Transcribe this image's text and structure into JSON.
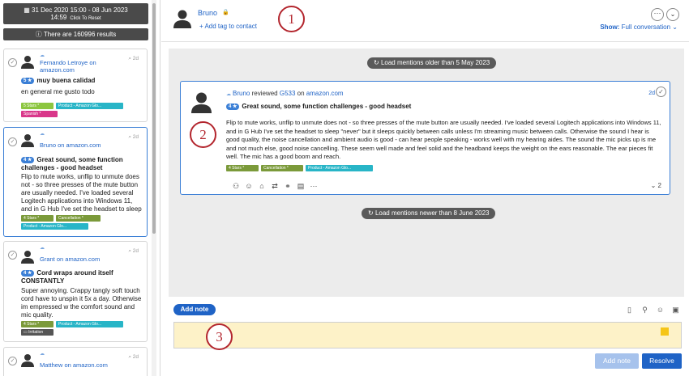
{
  "sidebar": {
    "date_range": "31 Dec 2020 15:00 - 08 Jun 2023",
    "date_time": "14:59",
    "reset_label": "Click To Reset",
    "results": "There are 160996 results",
    "cards": [
      {
        "name": "Fernando Letroye",
        "source": "on amazon.com",
        "age": "2d",
        "stars": "5 ★",
        "title": "muy buena calidad",
        "body": "en general me gusto todo",
        "tags": [
          "5 Stars *",
          "Product - Amazon Glo...",
          "Spanish *"
        ]
      },
      {
        "name": "Bruno",
        "source": "on amazon.com",
        "age": "2d",
        "stars": "4 ★",
        "title": "Great sound, some function challenges - good headset",
        "body": "Flip to mute works, unflip to unmute does not - so three presses of the mute button are usually needed. I've loaded several Logitech applications into Windows 11, and in G Hub I've set the headset to sleep",
        "tags": [
          "4 Stars *",
          "Cancellation *",
          "Product - Amazon Glo..."
        ]
      },
      {
        "name": "Grant",
        "source": "on amazon.com",
        "age": "2d",
        "stars": "4 ★",
        "title": "Cord wraps around itself CONSTANTLY",
        "body": "Super annoying. Crappy tangly soft touch cord have to unspin it 5x a day. Otherwise im empressed w the comfort sound and mic quality.",
        "tags": [
          "4 Stars *",
          "Product - Amazon Glo...",
          "Irritation"
        ]
      },
      {
        "name": "Matthew",
        "source": "on amazon.com",
        "age": "2d"
      }
    ]
  },
  "header": {
    "contact_name": "Bruno",
    "add_tag": "+ Add tag to contact",
    "show_label": "Show:",
    "show_value": "Full conversation"
  },
  "conversation": {
    "load_older": "Load mentions older than 5 May 2023",
    "load_newer": "Load mentions newer than 8 June 2023",
    "message": {
      "author": "Bruno",
      "verb": "reviewed",
      "product": "G533",
      "on": "on",
      "site": "amazon.com",
      "age": "2d",
      "stars": "4 ★",
      "title": "Great sound, some function challenges - good headset",
      "body": "Flip to mute works, unflip to unmute does not - so three presses of the mute button are usually needed. I've loaded several Logitech applications into Windows 11, and in G Hub I've set the headset to sleep \"never\" but it sleeps quickly between calls unless I'm streaming music between calls. Otherwise the sound I hear is good quality, the noise cancellation and ambient audio is good - can hear people speaking - works well with my hearing aides. The sound the mic picks up is me and not much else, good noise cancelling. These seem well made and feel solid and the headband keeps the weight on the ears reasonable. The ear pieces fit well. The mic has a good boom and reach.",
      "tags": [
        "4 Stars *",
        "Cancellation *",
        "Product - Amazon Glo..."
      ],
      "reply_count": "2"
    }
  },
  "note": {
    "tab_label": "Add note",
    "add_button": "Add note",
    "resolve_button": "Resolve"
  },
  "markers": [
    "1",
    "2",
    "3"
  ],
  "colors": {
    "accent": "#1f63c6",
    "marker": "#b3262e",
    "note_bg": "#fdf2c8"
  }
}
